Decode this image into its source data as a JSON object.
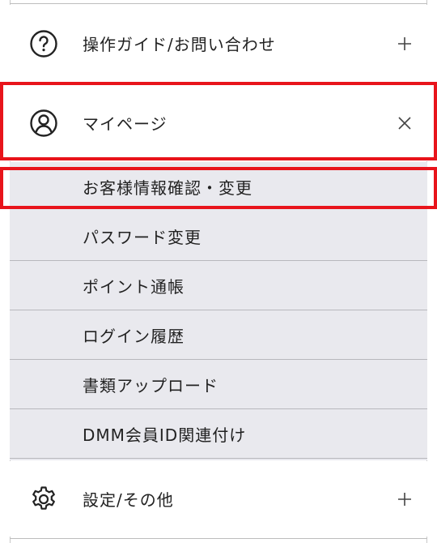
{
  "menu": {
    "guide": {
      "label": "操作ガイド/お問い合わせ",
      "icon": "question-circle-icon",
      "action_icon": "plus-icon"
    },
    "mypage": {
      "label": "マイページ",
      "icon": "user-circle-icon",
      "action_icon": "close-icon"
    },
    "settings": {
      "label": "設定/その他",
      "icon": "gear-icon",
      "action_icon": "plus-icon"
    }
  },
  "submenu": {
    "items": [
      {
        "label": "お客様情報確認・変更"
      },
      {
        "label": "パスワード変更"
      },
      {
        "label": "ポイント通帳"
      },
      {
        "label": "ログイン履歴"
      },
      {
        "label": "書類アップロード"
      },
      {
        "label": "DMM会員ID関連付け"
      }
    ]
  },
  "colors": {
    "highlight": "#e8141b",
    "submenu_bg": "#e9e9ee",
    "text": "#222222"
  }
}
